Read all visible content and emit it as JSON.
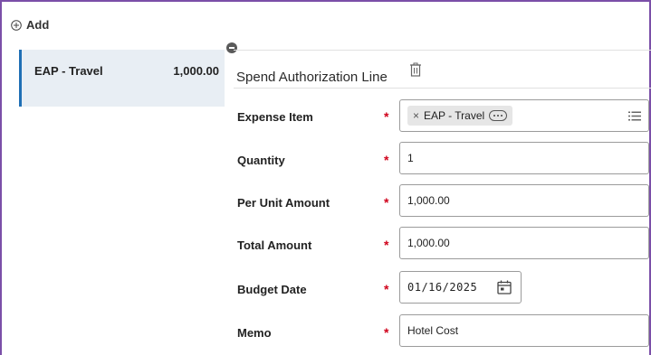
{
  "toolbar": {
    "add_label": "Add"
  },
  "lines": [
    {
      "name": "EAP - Travel",
      "amount": "1,000.00"
    }
  ],
  "form": {
    "title": "Spend Authorization Line",
    "required_marker": "*",
    "fields": {
      "expense_item": {
        "label": "Expense Item",
        "value": "EAP - Travel"
      },
      "quantity": {
        "label": "Quantity",
        "value": "1"
      },
      "per_unit_amount": {
        "label": "Per Unit Amount",
        "value": "1,000.00"
      },
      "total_amount": {
        "label": "Total Amount",
        "value": "1,000.00"
      },
      "budget_date": {
        "label": "Budget Date",
        "value": "01/16/2025"
      },
      "memo": {
        "label": "Memo",
        "value": "Hotel Cost"
      }
    }
  },
  "icons": {
    "add": "plus-circle-icon",
    "remove": "minus-circle-icon",
    "delete": "trash-icon",
    "pill_remove": "close-icon",
    "pill_more": "ellipsis-icon",
    "prompt": "list-icon",
    "date": "calendar-icon"
  },
  "colors": {
    "accent": "#1f6fb5",
    "required": "#d0021b",
    "card_bg": "#e8eef4",
    "frame": "#7b4fa8"
  }
}
